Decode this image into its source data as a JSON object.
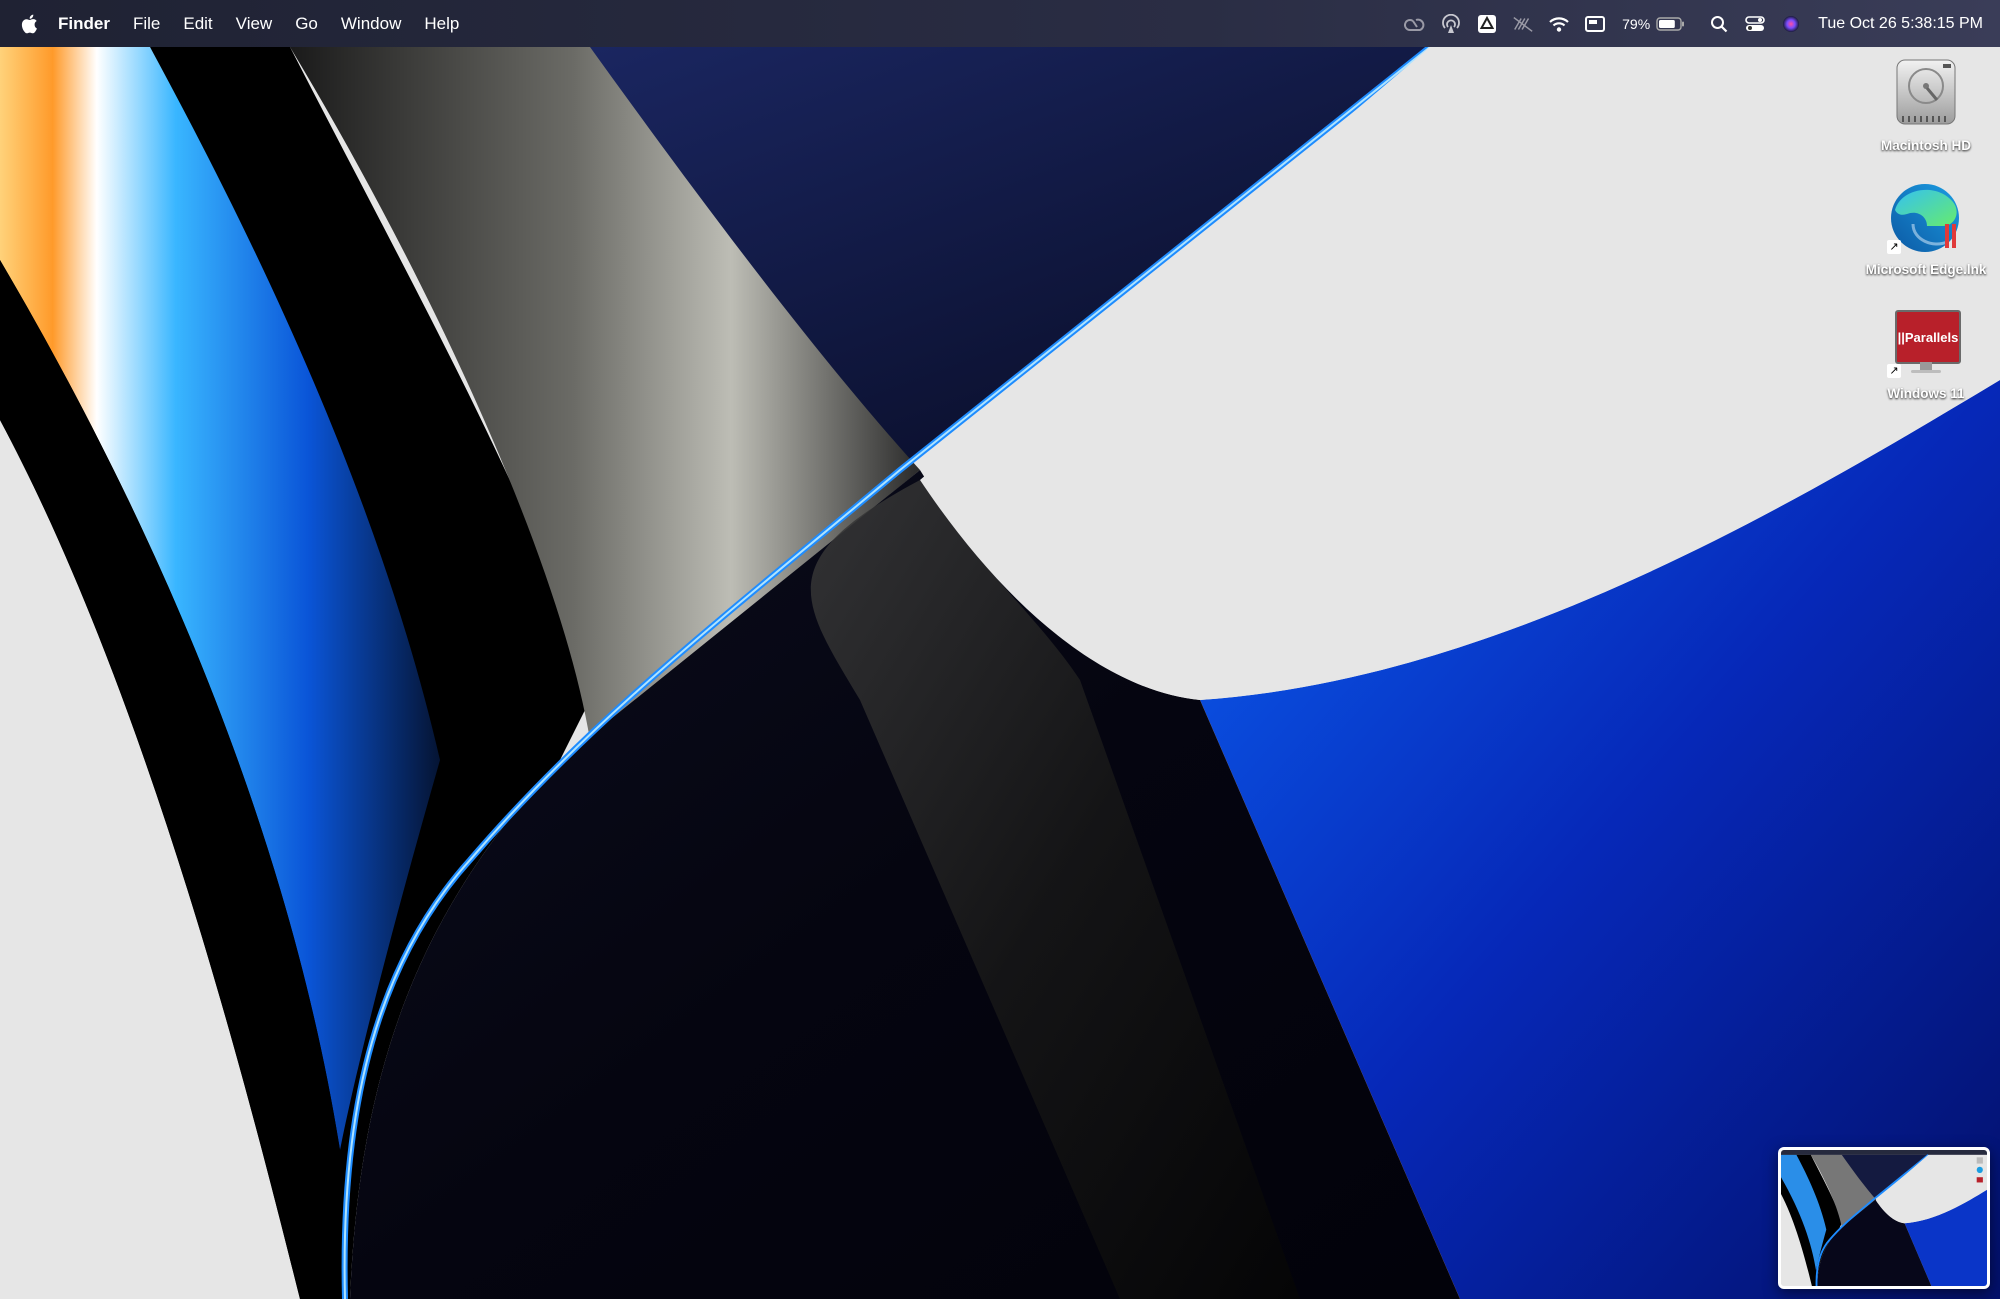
{
  "menubar": {
    "apple_icon": "apple-logo",
    "app_name": "Finder",
    "menus": [
      "File",
      "Edit",
      "View",
      "Go",
      "Window",
      "Help"
    ],
    "status": {
      "icons": [
        "creative-cloud-icon",
        "airdrop-icon",
        "google-drive-icon",
        "mute-icon",
        "wifi-icon",
        "display-icon"
      ],
      "battery_percent": "79%",
      "battery_level": 0.79,
      "extra_icons": [
        "spotlight-search-icon",
        "control-center-icon",
        "siri-icon"
      ],
      "clock": "Tue Oct 26  5:38:15 PM"
    }
  },
  "desktop": {
    "icons": [
      {
        "label": "Macintosh HD",
        "icon": "hard-drive-icon"
      },
      {
        "label": "Microsoft Edge.lnk",
        "icon": "edge-icon"
      },
      {
        "label": "Windows 11",
        "icon": "parallels-icon",
        "badge": "||Parallels"
      }
    ]
  },
  "thumbnail": {
    "icon": "screenshot-preview"
  },
  "colors": {
    "menubar": "#262a3e",
    "wallpaper_bg": "#e6e6e6",
    "accent_blue": "#0a2fd0"
  }
}
